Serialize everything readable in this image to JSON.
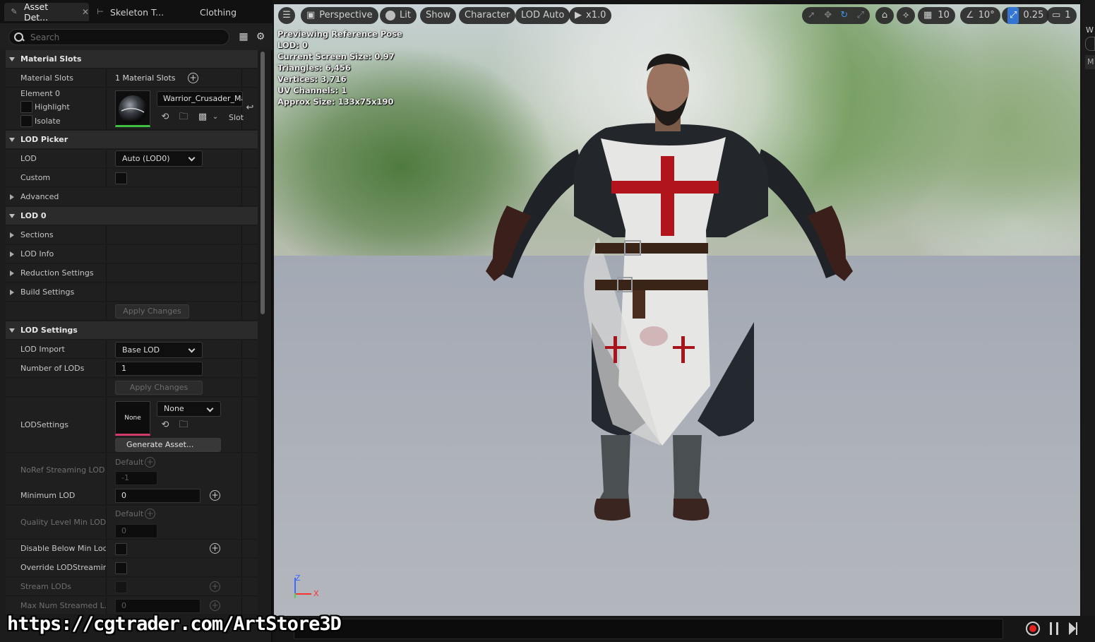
{
  "tabs": [
    {
      "label": "Asset Det...",
      "close": "✕"
    },
    {
      "label": "Skeleton T..."
    },
    {
      "label": "Clothing"
    }
  ],
  "search": {
    "placeholder": "Search"
  },
  "material_slots": {
    "category": "Material Slots",
    "row_label": "Material Slots",
    "count": "1 Material Slots",
    "element": "Element 0",
    "highlight": "Highlight",
    "isolate": "Isolate",
    "material_name": "Warrior_Crusader_Mat",
    "slot_label": "Slot"
  },
  "lod_picker": {
    "category": "LOD Picker",
    "lod_label": "LOD",
    "lod_value": "Auto (LOD0)",
    "custom_label": "Custom",
    "advanced_label": "Advanced"
  },
  "lod0": {
    "category": "LOD 0",
    "sections": "Sections",
    "lod_info": "LOD Info",
    "reduction": "Reduction Settings",
    "build": "Build Settings",
    "apply": "Apply Changes"
  },
  "lod_settings": {
    "category": "LOD Settings",
    "lod_import_label": "LOD Import",
    "lod_import_value": "Base LOD",
    "num_lods_label": "Number of LODs",
    "num_lods_value": "1",
    "apply": "Apply Changes",
    "lodsettings_label": "LODSettings",
    "lodsettings_thumb": "None",
    "lodsettings_combo": "None",
    "generate": "Generate Asset...",
    "noref_label": "NoRef Streaming LOD B",
    "noref_default": "Default",
    "noref_value": "-1",
    "min_lod_label": "Minimum LOD",
    "min_lod_value": "0",
    "quality_label": "Quality Level Min LOD",
    "quality_default": "Default",
    "quality_value": "0",
    "disable_label": "Disable Below Min Lod...",
    "override_label": "Override LODStreamin...",
    "stream_label": "Stream LODs",
    "max_num_label": "Max Num Streamed L...",
    "max_num_value": "0"
  },
  "viewport": {
    "perspective": "Perspective",
    "lit": "Lit",
    "show": "Show",
    "character": "Character",
    "lod_auto": "LOD Auto",
    "play_speed": "x1.0",
    "grid_snap": "10",
    "angle_snap": "10°",
    "scale_snap": "0.25",
    "camera_speed": "1",
    "stats": [
      "Previewing Reference Pose",
      "LOD: 0",
      "Current Screen Size: 0.97",
      "Triangles: 6,456",
      "Vertices: 3,716",
      "UV Channels: 1",
      "Approx Size: 133x75x190"
    ],
    "axis_z": "Z",
    "axis_x": "X"
  },
  "right_panel": {
    "label_w": "W",
    "label_m": "M"
  },
  "watermark": "https://cgtrader.com/ArtStore3D",
  "colors": {
    "accent": "#3d8ef0",
    "record": "#e02424",
    "cross": "#b2141c"
  }
}
